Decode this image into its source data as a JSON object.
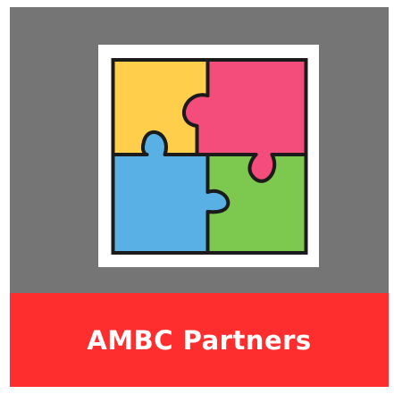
{
  "banner": {
    "title": "AMBC Partners"
  },
  "colors": {
    "background_gray": "#757575",
    "banner_red": "#ff2e2e",
    "tile_white": "#ffffff",
    "piece_yellow": "#ffcf4b",
    "piece_pink": "#f44c7b",
    "piece_blue": "#59b0e5",
    "piece_green": "#7dc94f",
    "outline": "#1b1b1b"
  },
  "logo": {
    "icon": "puzzle-pieces-icon"
  }
}
